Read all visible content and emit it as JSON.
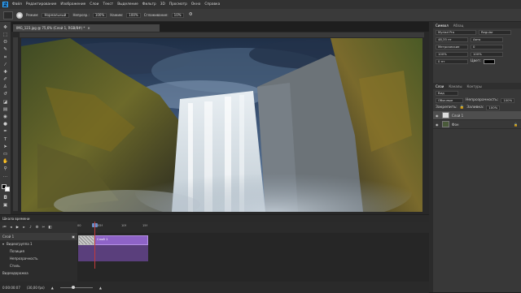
{
  "menubar": {
    "logo": "Ps",
    "items": [
      "Файл",
      "Редактирование",
      "Изображение",
      "Слои",
      "Текст",
      "Выделение",
      "Фильтр",
      "3D",
      "Просмотр",
      "Окно",
      "Справка"
    ]
  },
  "options": {
    "mode_label": "Режим:",
    "mode_value": "Нормальный",
    "opacity_label": "Непрозр.:",
    "opacity_value": "100%",
    "flow_label": "Нажим:",
    "flow_value": "100%",
    "smoothing_label": "Сглаживание:",
    "smoothing_value": "10%"
  },
  "document": {
    "tab_title": "IMG_123.jpg @ 75,6% (Слой 1, RGB/8#) *",
    "close_glyph": "×"
  },
  "panels": {
    "top_tabs": [
      "Символ",
      "Абзац"
    ],
    "font_family": "Myriad Pro",
    "font_style": "Regular",
    "font_size": "48,35 пт",
    "leading": "Авто",
    "tracking_label": "Метрические",
    "tracking_value": "0",
    "scale_v": "100%",
    "scale_h": "100%",
    "baseline": "0 пт",
    "color_label": "Цвет:",
    "layers_tabs": [
      "Слои",
      "Каналы",
      "Контуры"
    ],
    "filter_label": "Вид",
    "blend_mode": "Обычные",
    "opacity_label": "Непрозрачность:",
    "opacity_value": "100%",
    "lock_label": "Закрепить:",
    "fill_label": "Заливка:",
    "fill_value": "100%",
    "layers": [
      {
        "name": "Слой 1",
        "active": true
      },
      {
        "name": "Фон",
        "active": false
      }
    ]
  },
  "timeline": {
    "title": "Шкала времени",
    "ticks": [
      "00",
      "05f",
      "10f",
      "15f",
      "01:00f"
    ],
    "track_name": "Слой 1",
    "group_name": "Видеогруппа 1",
    "sub_rows": [
      "Позиция",
      "Непрозрачность",
      "Стиль"
    ],
    "footer_left": "Видеодорожка",
    "timecode": "0:00:00:07",
    "fps": "(30,00 fps)",
    "clip_label": "Слой 1"
  },
  "colors": {
    "accent_clip": "#8e63c7",
    "playhead": "#c23a3a"
  }
}
